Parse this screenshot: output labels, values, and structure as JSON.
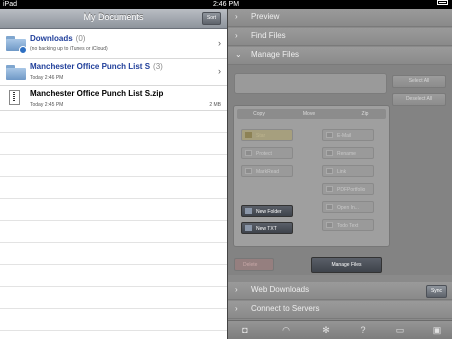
{
  "status_bar": {
    "carrier": "iPad",
    "time": "2:46 PM"
  },
  "documents": {
    "title": "My Documents",
    "sort_label": "Sort",
    "items": [
      {
        "name": "Downloads",
        "count": "(0)",
        "subtitle": "(no backing up to iTunes or iCloud)",
        "size": "",
        "icon": "folder-icon"
      },
      {
        "name": "Manchester Office Punch List S",
        "count": "(3)",
        "subtitle": "Today 2:46 PM",
        "size": "",
        "icon": "folder-icon"
      },
      {
        "name": "Manchester Office Punch List S.zip",
        "count": "",
        "subtitle": "Today 2:45 PM",
        "size": "2 MB",
        "icon": "zip-file-icon"
      }
    ]
  },
  "panels": {
    "preview": "Preview",
    "find_files": "Find Files",
    "manage_files": "Manage Files",
    "web_downloads": "Web Downloads",
    "connect_servers": "Connect to Servers",
    "sync_label": "Sync"
  },
  "manage": {
    "select_all": "Select All",
    "deselect_all": "Deselect All",
    "tabs": [
      "Copy",
      "Move",
      "Zip"
    ],
    "ops": {
      "star": "Star",
      "protect": "Protect",
      "markread": "MarkRead",
      "new_folder": "New Folder",
      "new_txt": "New TXT",
      "email": "E-Mail",
      "rename": "Rename",
      "link": "Link",
      "pdf": "PDFPortfolio",
      "open_in": "Open In...",
      "todo": "Todo Text"
    },
    "delete_label": "Delete",
    "manage_files_button": "Manage Files"
  },
  "toolbar_icons": [
    "camera-icon",
    "wifi-icon",
    "gear-icon",
    "help-icon",
    "screen-icon",
    "lock-icon"
  ]
}
